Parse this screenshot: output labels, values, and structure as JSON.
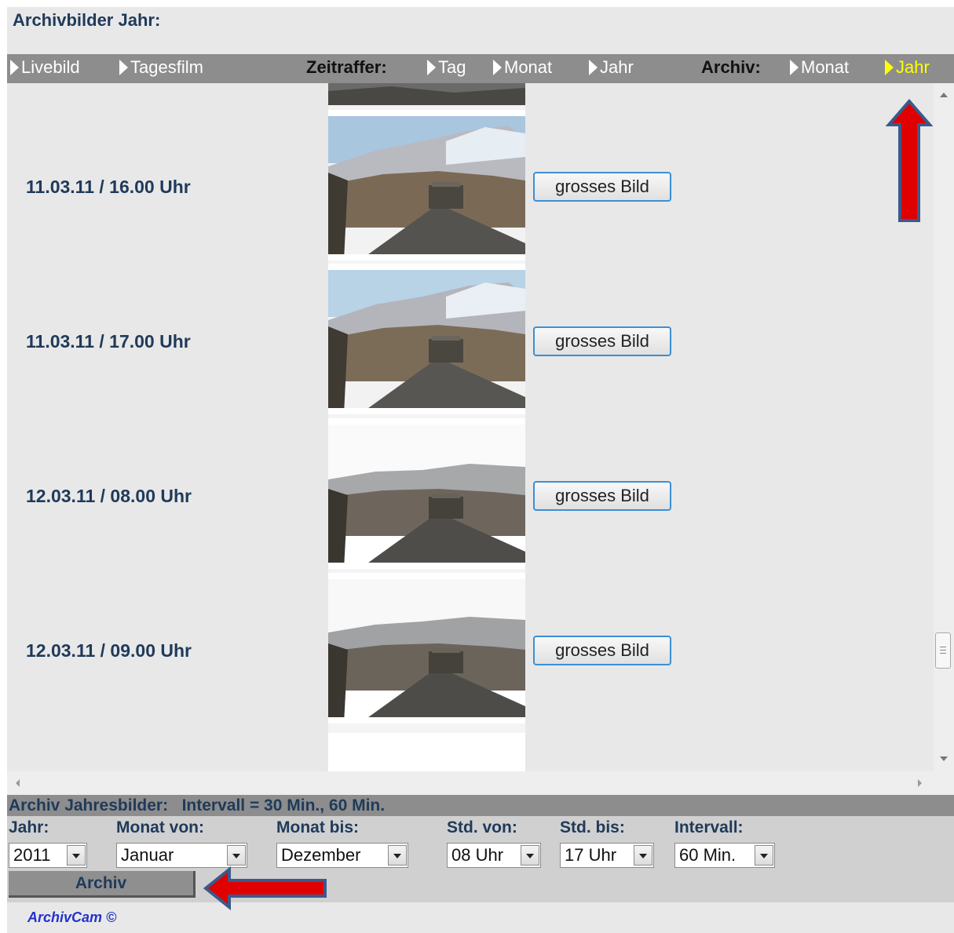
{
  "header": {
    "title": "Archivbilder Jahr:"
  },
  "nav": {
    "livebild": "Livebild",
    "tagesfilm": "Tagesfilm",
    "zeitraffer_label": "Zeitraffer:",
    "zr_tag": "Tag",
    "zr_monat": "Monat",
    "zr_jahr": "Jahr",
    "archiv_label": "Archiv:",
    "ar_monat": "Monat",
    "ar_jahr": "Jahr"
  },
  "entries": [
    {
      "time": "11.03.11 / 16.00 Uhr",
      "button": "grosses Bild"
    },
    {
      "time": "11.03.11 / 17.00 Uhr",
      "button": "grosses Bild"
    },
    {
      "time": "12.03.11 / 08.00 Uhr",
      "button": "grosses Bild"
    },
    {
      "time": "12.03.11 / 09.00 Uhr",
      "button": "grosses Bild"
    }
  ],
  "archive": {
    "header": "Archiv Jahresbilder:   Intervall = 30 Min., 60 Min.",
    "jahr_label": "Jahr:",
    "jahr_value": "2011",
    "monat_von_label": "Monat von:",
    "monat_von_value": "Januar",
    "monat_bis_label": "Monat bis:",
    "monat_bis_value": "Dezember",
    "std_von_label": "Std. von:",
    "std_von_value": "08 Uhr",
    "std_bis_label": "Std. bis:",
    "std_bis_value": "17 Uhr",
    "intervall_label": "Intervall:",
    "intervall_value": "60 Min.",
    "submit_label": "Archiv"
  },
  "footer": {
    "brand": "ArchivCam ©"
  },
  "colors": {
    "nav_bg": "#8d8d8d",
    "active_nav": "#ffff00",
    "button_border": "#3c8fd4",
    "annotation_arrow": "#e00000",
    "annotation_outline": "#3a5a8a"
  },
  "annotations": [
    {
      "name": "up-arrow",
      "points_to": "Jahr"
    },
    {
      "name": "left-arrow",
      "points_to": "Archiv"
    }
  ]
}
